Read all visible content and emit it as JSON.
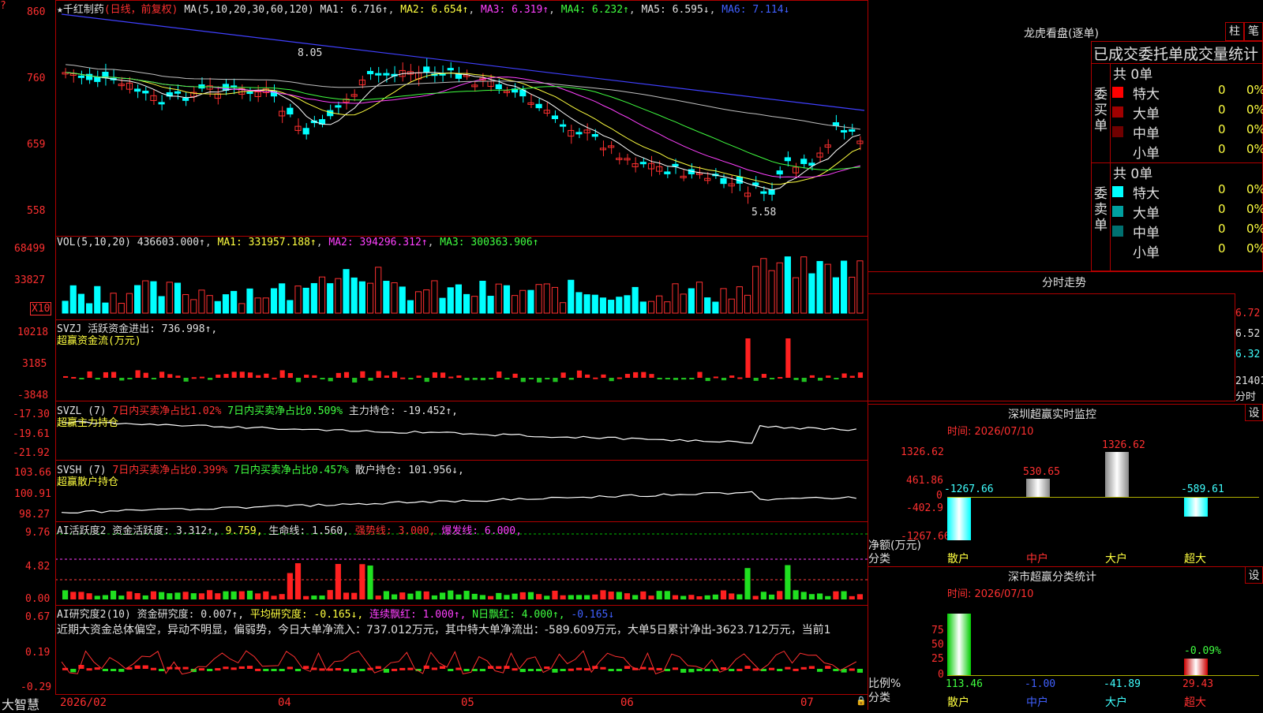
{
  "stock": {
    "name": "千红制药",
    "mode": "(日线，前复权)",
    "star": "★",
    "corner": "?"
  },
  "ma_header": {
    "prefix": "MA(5,10,20,30,60,120)",
    "ma1": "MA1: 6.716↑",
    "ma2": "MA2: 6.654↑",
    "ma3": "MA3: 6.319↑",
    "ma4": "MA4: 6.232↑",
    "ma5": "MA5: 6.595↓",
    "ma6": "MA6: 7.114↓"
  },
  "main_axis": [
    "860",
    "760",
    "659",
    "558"
  ],
  "annotations": {
    "high": "8.05",
    "low": "5.58"
  },
  "vol": {
    "label": "VOL(5,10,20)",
    "value": "436603.000↑",
    "ma1": "MA1: 331957.188↑",
    "ma2": "MA2: 394296.312↑",
    "ma3": "MA3: 300363.906↑",
    "axis": [
      "68499",
      "33827"
    ],
    "unit": "X10"
  },
  "svzj": {
    "label": "SVZJ  活跃资金进出: 736.998↑,",
    "sub": "超赢资金流(万元)",
    "axis": [
      "10218",
      "3185",
      "-3848"
    ]
  },
  "svzl": {
    "label": "SVZL (7)",
    "p1": "7日内买卖净占比1.02%",
    "p2": "7日内买卖净占比0.509%",
    "p3": "主力持仓: -19.452↑,",
    "sub": "超赢主力持仓",
    "axis": [
      "-17.30",
      "-19.61",
      "-21.92"
    ]
  },
  "svsh": {
    "label": "SVSH (7)",
    "p1": "7日内买卖净占比0.399%",
    "p2": "7日内买卖净占比0.457%",
    "p3": "散户持仓: 101.956↓,",
    "sub": "超赢散户持仓",
    "axis": [
      "103.66",
      "100.91",
      "98.27"
    ]
  },
  "ai1": {
    "label": "AI活跃度2 资金活跃度: 3.312↑,",
    "v2": "9.759,",
    "v3": "生命线: 1.560,",
    "v4": "强势线: 3.000,",
    "v5": "爆发线: 6.000,",
    "axis": [
      "9.76",
      "4.82",
      "0.00"
    ]
  },
  "ai2": {
    "label": "AI研究度2(10) 资金研究度: 0.007↑,",
    "v2": "平均研究度: -0.165↓,",
    "v3": "连续飘红: 1.000↑,",
    "v4": "N日飘红: 4.000↑,",
    "v5": "-0.165↓",
    "comment": "近期大资金总体偏空，异动不明显，偏弱势，今日大单净流入：737.012万元，其中特大单净流出：-589.609万元，大单5日累计净出-3623.712万元，当前1",
    "axis": [
      "0.67",
      "0.19",
      "-0.29"
    ]
  },
  "x_axis": [
    "2026/02",
    "04",
    "05",
    "06",
    "07"
  ],
  "brand": "大智慧",
  "lhb": {
    "title": "龙虎看盘(逐单)",
    "btn1": "柱",
    "btn2": "笔",
    "tabs": "已成交委托单成交量统计",
    "buy_total": "共 0单",
    "sell_total": "共 0单",
    "buy_label": "委买单",
    "sell_label": "委卖单",
    "buy_rows": [
      {
        "name": "特大",
        "v": "0",
        "p": "0%",
        "color": "#ff0000"
      },
      {
        "name": "大单",
        "v": "0",
        "p": "0%",
        "color": "#a00000"
      },
      {
        "name": "中单",
        "v": "0",
        "p": "0%",
        "color": "#700000"
      },
      {
        "name": "小单",
        "v": "0",
        "p": "0%",
        "color": "#000000"
      }
    ],
    "sell_rows": [
      {
        "name": "特大",
        "v": "0",
        "p": "0%",
        "color": "#00ffff"
      },
      {
        "name": "大单",
        "v": "0",
        "p": "0%",
        "color": "#00a0a0"
      },
      {
        "name": "中单",
        "v": "0",
        "p": "0%",
        "color": "#007070"
      },
      {
        "name": "小单",
        "v": "0",
        "p": "0%",
        "color": "#000000"
      }
    ]
  },
  "intraday": {
    "title": "分时走势",
    "axis": [
      "6.72",
      "6.52",
      "6.32"
    ],
    "vol_axis": "21401",
    "vol_unit": "分时"
  },
  "monitor": {
    "title": "深圳超赢实时监控",
    "set": "设",
    "time": "时间: 2026/07/10",
    "axis": [
      "1326.62",
      "461.86",
      "0",
      "-402.9",
      "-1267.66"
    ],
    "axis_label": "净额(万元)",
    "cat_label": "分类",
    "cats": [
      "散户",
      "中户",
      "大户",
      "超大"
    ],
    "values": [
      -1267.66,
      530.65,
      1326.62,
      -589.61
    ],
    "value_labels": [
      "-1267.66",
      "530.65",
      "1326.62",
      "-589.61"
    ]
  },
  "classify": {
    "title": "深市超赢分类统计",
    "set": "设",
    "time": "时间: 2026/07/10",
    "axis": [
      "75",
      "50",
      "25",
      "0"
    ],
    "axis_label": "比例%",
    "cat_label": "分类",
    "cats": [
      "散户",
      "中户",
      "大户",
      "超大"
    ],
    "values": [
      113.46,
      -1.0,
      -41.89,
      29.43
    ],
    "value_labels": [
      "113.46",
      "-1.00",
      "-41.89",
      "29.43"
    ],
    "extra": "-0.09%"
  },
  "colors": {
    "up": "#ff3030",
    "down": "#00ffff",
    "border": "#b00000"
  }
}
